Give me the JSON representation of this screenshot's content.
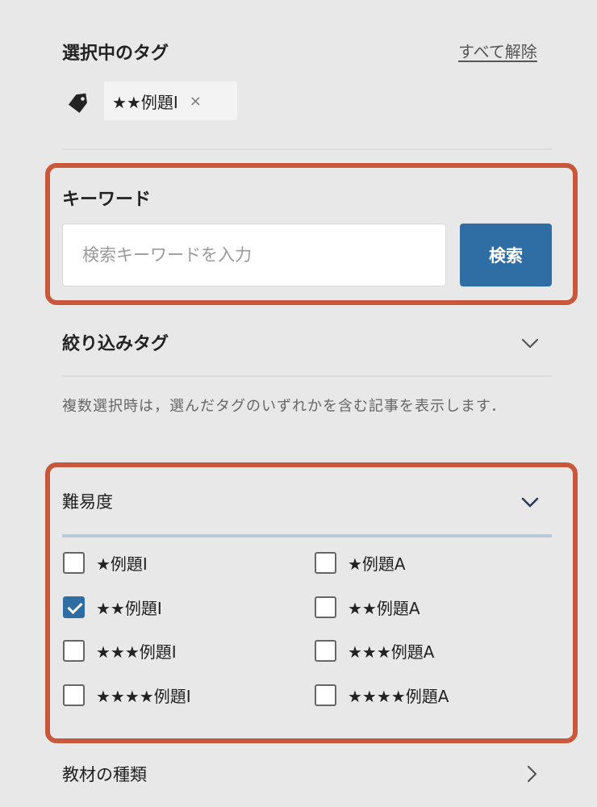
{
  "selected_tags": {
    "title": "選択中のタグ",
    "clear_all": "すべて解除",
    "tag_icon": "tag-icon",
    "chips": [
      {
        "label": "★★例題I",
        "remove": "×"
      }
    ]
  },
  "keyword": {
    "title": "キーワード",
    "placeholder": "検索キーワードを入力",
    "value": "",
    "button": "検索"
  },
  "filter": {
    "title": "絞り込みタグ",
    "help": "複数選択時は，選んだタグのいずれかを含む記事を表示します．"
  },
  "difficulty": {
    "title": "難易度",
    "options": [
      {
        "label": "★例題I",
        "checked": false
      },
      {
        "label": "★例題A",
        "checked": false
      },
      {
        "label": "★★例題I",
        "checked": true
      },
      {
        "label": "★★例題A",
        "checked": false
      },
      {
        "label": "★★★例題I",
        "checked": false
      },
      {
        "label": "★★★例題A",
        "checked": false
      },
      {
        "label": "★★★★例題I",
        "checked": false
      },
      {
        "label": "★★★★例題A",
        "checked": false
      }
    ]
  },
  "material": {
    "title": "教材の種類"
  },
  "colors": {
    "accent": "#2f6ea5",
    "highlight": "#c9573b",
    "background": "#e8e8e8"
  }
}
